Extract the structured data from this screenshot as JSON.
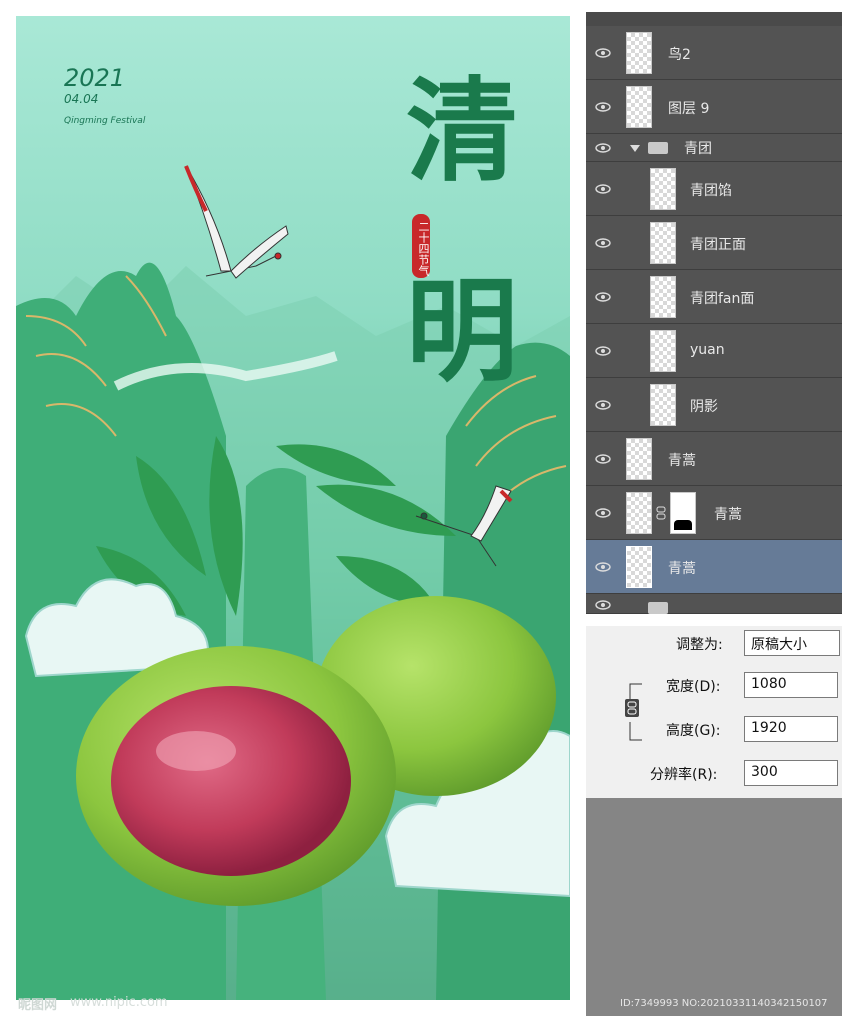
{
  "poster": {
    "year": "2021",
    "date": "04.04",
    "festival": "Qingming Festival",
    "title_char_1": "清",
    "title_char_2": "明",
    "seal_text": "二十四节气",
    "colors": {
      "sky": "#a9e8d6",
      "mountain": "#3fae78",
      "title": "#1a7a4c",
      "seal": "#c8282a",
      "bean_filling": "#c13b5a",
      "rice_cake": "#8cc63f"
    }
  },
  "layers_panel": {
    "layers": [
      {
        "name": "鸟2",
        "type": "layer",
        "icon": "eye-icon"
      },
      {
        "name": "图层 9",
        "type": "layer",
        "icon": "eye-icon"
      },
      {
        "name": "青团",
        "type": "group",
        "icon": "folder-icon"
      },
      {
        "name": "青团馅",
        "type": "layer",
        "icon": "eye-icon"
      },
      {
        "name": "青团正面",
        "type": "layer",
        "icon": "eye-icon"
      },
      {
        "name": "青团fan面",
        "type": "layer",
        "icon": "eye-icon"
      },
      {
        "name": "yuan",
        "type": "layer",
        "icon": "eye-icon"
      },
      {
        "name": "阴影",
        "type": "layer",
        "icon": "eye-icon"
      },
      {
        "name": "青蒿",
        "type": "layer",
        "icon": "eye-icon"
      },
      {
        "name": "青蒿",
        "type": "masked-layer",
        "icon": "link-icon"
      },
      {
        "name": "青蒿",
        "type": "layer",
        "selected": true,
        "icon": "eye-icon"
      }
    ]
  },
  "image_size": {
    "resize_label": "调整为:",
    "resize_value": "原稿大小",
    "width_label": "宽度(D):",
    "width_value": "1080",
    "height_label": "高度(G):",
    "height_value": "1920",
    "resolution_label": "分辨率(R):",
    "resolution_value": "300"
  },
  "watermark": {
    "site": "昵图网",
    "url": "www.nipic.com",
    "id": "ID:7349993 NO:20210331140342150107"
  }
}
